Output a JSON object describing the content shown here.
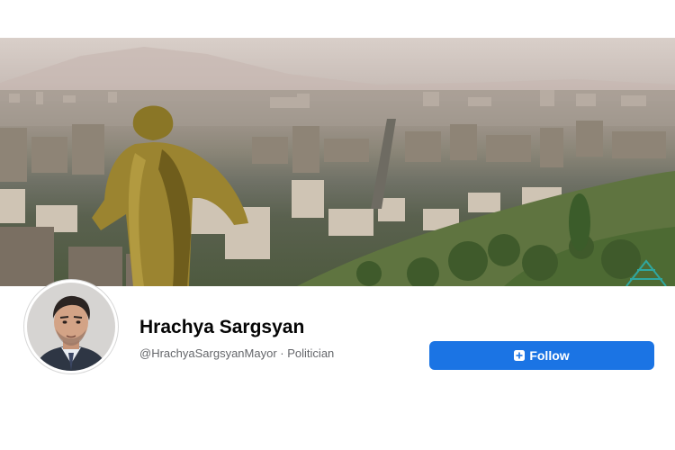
{
  "profile": {
    "name": "Hrachya Sargsyan",
    "handle": "@HrachyaSargsyanMayor",
    "separator": "·",
    "category": "Politician"
  },
  "actions": {
    "follow_label": "Follow"
  },
  "colors": {
    "primary_button": "#1b74e4",
    "name_text": "#050505",
    "secondary_text": "#65676b"
  },
  "icons": {
    "follow": "follow-plus-icon"
  }
}
